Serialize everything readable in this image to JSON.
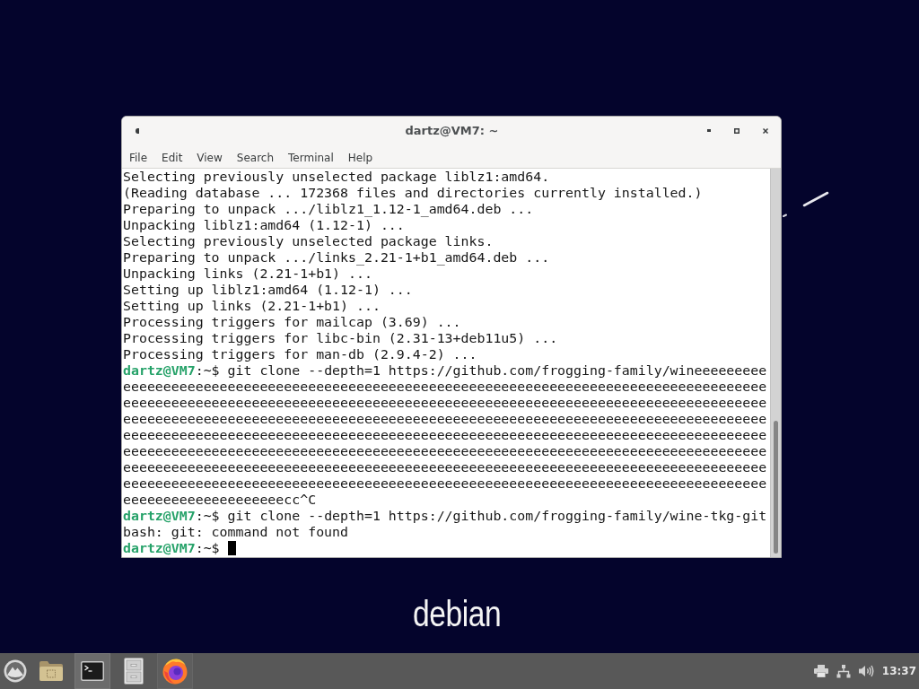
{
  "desktop": {
    "logo_text": "debian"
  },
  "window": {
    "title": "dartz@VM7: ~",
    "menu": [
      "File",
      "Edit",
      "View",
      "Search",
      "Terminal",
      "Help"
    ]
  },
  "terminal": {
    "lines": [
      {
        "kind": "text",
        "text": "Selecting previously unselected package liblz1:amd64."
      },
      {
        "kind": "text",
        "text": "(Reading database ... 172368 files and directories currently installed.)"
      },
      {
        "kind": "text",
        "text": "Preparing to unpack .../liblz1_1.12-1_amd64.deb ..."
      },
      {
        "kind": "text",
        "text": "Unpacking liblz1:amd64 (1.12-1) ..."
      },
      {
        "kind": "text",
        "text": "Selecting previously unselected package links."
      },
      {
        "kind": "text",
        "text": "Preparing to unpack .../links_2.21-1+b1_amd64.deb ..."
      },
      {
        "kind": "text",
        "text": "Unpacking links (2.21-1+b1) ..."
      },
      {
        "kind": "text",
        "text": "Setting up liblz1:amd64 (1.12-1) ..."
      },
      {
        "kind": "text",
        "text": "Setting up links (2.21-1+b1) ..."
      },
      {
        "kind": "text",
        "text": "Processing triggers for mailcap (3.69) ..."
      },
      {
        "kind": "text",
        "text": "Processing triggers for libc-bin (2.31-13+deb11u5) ..."
      },
      {
        "kind": "text",
        "text": "Processing triggers for man-db (2.9.4-2) ..."
      },
      {
        "kind": "prompt",
        "user_host": "dartz@VM7",
        "prompt_tail": ":~$",
        "command": "git clone --depth=1 https://github.com/frogging-family/wineeeeeeeee",
        "cursor": false
      },
      {
        "kind": "text",
        "text": "eeeeeeeeeeeeeeeeeeeeeeeeeeeeeeeeeeeeeeeeeeeeeeeeeeeeeeeeeeeeeeeeeeeeeeeeeeeeeeee"
      },
      {
        "kind": "text",
        "text": "eeeeeeeeeeeeeeeeeeeeeeeeeeeeeeeeeeeeeeeeeeeeeeeeeeeeeeeeeeeeeeeeeeeeeeeeeeeeeeee"
      },
      {
        "kind": "text",
        "text": "eeeeeeeeeeeeeeeeeeeeeeeeeeeeeeeeeeeeeeeeeeeeeeeeeeeeeeeeeeeeeeeeeeeeeeeeeeeeeeee"
      },
      {
        "kind": "text",
        "text": "eeeeeeeeeeeeeeeeeeeeeeeeeeeeeeeeeeeeeeeeeeeeeeeeeeeeeeeeeeeeeeeeeeeeeeeeeeeeeeee"
      },
      {
        "kind": "text",
        "text": "eeeeeeeeeeeeeeeeeeeeeeeeeeeeeeeeeeeeeeeeeeeeeeeeeeeeeeeeeeeeeeeeeeeeeeeeeeeeeeee"
      },
      {
        "kind": "text",
        "text": "eeeeeeeeeeeeeeeeeeeeeeeeeeeeeeeeeeeeeeeeeeeeeeeeeeeeeeeeeeeeeeeeeeeeeeeeeeeeeeee"
      },
      {
        "kind": "text",
        "text": "eeeeeeeeeeeeeeeeeeeeeeeeeeeeeeeeeeeeeeeeeeeeeeeeeeeeeeeeeeeeeeeeeeeeeeeeeeeeeeee"
      },
      {
        "kind": "text",
        "text": "eeeeeeeeeeeeeeeeeeeecc^C"
      },
      {
        "kind": "prompt",
        "user_host": "dartz@VM7",
        "prompt_tail": ":~$",
        "command": "git clone --depth=1 https://github.com/frogging-family/wine-tkg-git",
        "cursor": false
      },
      {
        "kind": "text",
        "text": "bash: git: command not found"
      },
      {
        "kind": "prompt",
        "user_host": "dartz@VM7",
        "prompt_tail": ":~$",
        "cursor": true
      }
    ]
  },
  "taskbar": {
    "tasks": [
      {
        "kind": "folder",
        "selected": false,
        "open": false
      },
      {
        "kind": "terminal",
        "selected": true,
        "open": true
      },
      {
        "kind": "files",
        "selected": false,
        "open": false
      },
      {
        "kind": "browser",
        "selected": false,
        "open": true
      }
    ],
    "tray": [
      {
        "kind": "printer"
      },
      {
        "kind": "network"
      },
      {
        "kind": "volume"
      }
    ],
    "clock": "13:37"
  }
}
